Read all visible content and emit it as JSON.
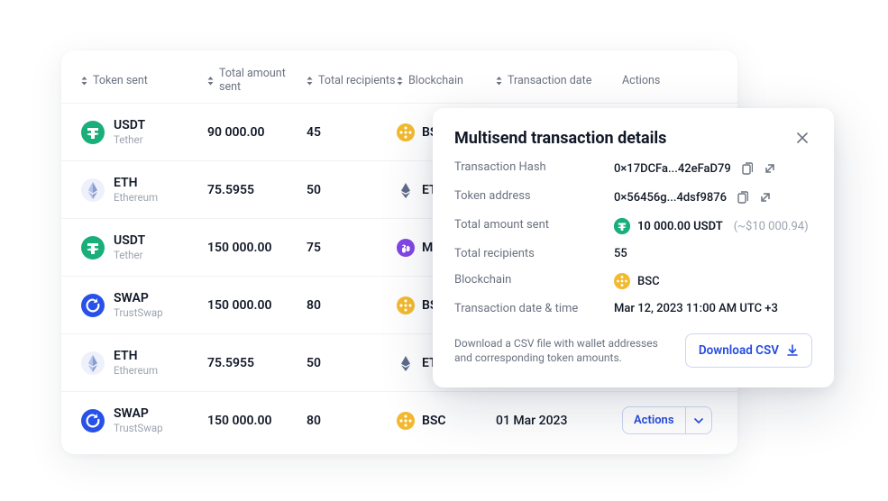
{
  "colors": {
    "accent": "#244ae0",
    "tether": "#1aaf7a",
    "eth": "#8a9ccf",
    "matic": "#8247e5",
    "swap": "#2751e8",
    "bsc": "#f3ba2f"
  },
  "table": {
    "headers": {
      "token": "Token sent",
      "amount": "Total amount sent",
      "recipients": "Total recipients",
      "blockchain": "Blockchain",
      "date": "Transaction date",
      "actions": "Actions"
    },
    "actions_label": "Actions",
    "rows": [
      {
        "symbol": "USDT",
        "name": "Tether",
        "icon": "tether",
        "amount": "90 000.00",
        "recipients": "45",
        "chain": "BSC",
        "chain_icon": "bsc",
        "date": ""
      },
      {
        "symbol": "ETH",
        "name": "Ethereum",
        "icon": "eth",
        "amount": "75.5955",
        "recipients": "50",
        "chain": "ETH",
        "chain_icon": "eth",
        "date": ""
      },
      {
        "symbol": "USDT",
        "name": "Tether",
        "icon": "tether",
        "amount": "150 000.00",
        "recipients": "75",
        "chain": "MATIC",
        "chain_icon": "matic",
        "date": ""
      },
      {
        "symbol": "SWAP",
        "name": "TrustSwap",
        "icon": "swap",
        "amount": "150 000.00",
        "recipients": "80",
        "chain": "BSC",
        "chain_icon": "bsc",
        "date": ""
      },
      {
        "symbol": "ETH",
        "name": "Ethereum",
        "icon": "eth",
        "amount": "75.5955",
        "recipients": "50",
        "chain": "ETH",
        "chain_icon": "eth",
        "date": ""
      },
      {
        "symbol": "SWAP",
        "name": "TrustSwap",
        "icon": "swap",
        "amount": "150 000.00",
        "recipients": "80",
        "chain": "BSC",
        "chain_icon": "bsc",
        "date": "01 Mar 2023"
      }
    ]
  },
  "details": {
    "title": "Multisend transaction details",
    "labels": {
      "hash": "Transaction Hash",
      "token_addr": "Token address",
      "total_amount": "Total amount sent",
      "total_recipients": "Total recipients",
      "blockchain": "Blockchain",
      "datetime": "Transaction date & time"
    },
    "hash": "0×17DCFa...42eFaD79",
    "token_address": "0×56456g...4dsf9876",
    "amount": "10 000.00 USDT",
    "amount_fiat": "(~$10 000.94)",
    "recipients": "55",
    "chain": "BSC",
    "chain_icon": "bsc",
    "datetime": "Mar 12, 2023 11:00 AM UTC +3",
    "csv_note": "Download a CSV file with wallet addresses and corresponding token amounts.",
    "download_label": "Download CSV"
  }
}
